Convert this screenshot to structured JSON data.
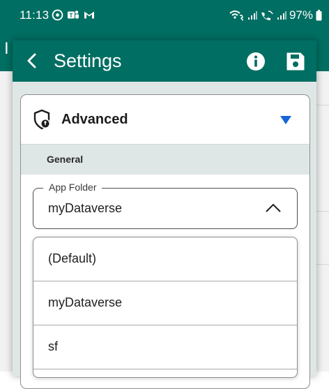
{
  "status_bar": {
    "time": "11:13",
    "battery": "97%",
    "left_icons": [
      "sync-icon",
      "teams-icon",
      "gmail-icon"
    ],
    "right_icons": [
      "wifi-calling-icon",
      "signal-icon",
      "wifi-calling-2-icon",
      "signal-2-icon",
      "battery-icon"
    ]
  },
  "background_app": {
    "title_fragment": "I"
  },
  "dialog": {
    "title": "Settings",
    "icons": {
      "back": "back-arrow-icon",
      "info": "info-icon",
      "save": "save-icon"
    }
  },
  "card": {
    "title": "Advanced",
    "icon": "shield-icon",
    "expand_icon": "triangle-down-icon",
    "section": "General"
  },
  "app_folder": {
    "label": "App Folder",
    "value": "myDataverse"
  },
  "dropdown": {
    "options": [
      "(Default)",
      "myDataverse",
      "sf"
    ]
  },
  "colors": {
    "app_bar": "#006e62",
    "section_bg": "#dfe6e6",
    "accent_blue": "#1565d8"
  }
}
